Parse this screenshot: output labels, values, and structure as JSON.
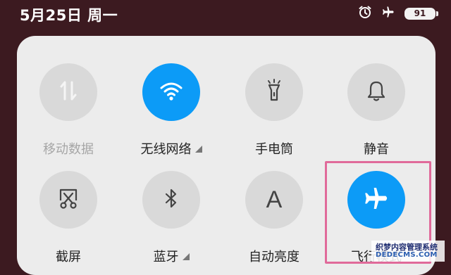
{
  "status_bar": {
    "date": "5月25日 周一",
    "battery_level": "91",
    "icons": [
      "alarm-icon",
      "airplane-icon",
      "battery-icon"
    ]
  },
  "tiles": [
    {
      "label": "移动数据",
      "icon": "data-arrows-icon",
      "active": false,
      "disabled": true
    },
    {
      "label": "无线网络",
      "icon": "wifi-icon",
      "active": true,
      "has_submenu": true
    },
    {
      "label": "手电筒",
      "icon": "flashlight-icon",
      "active": false
    },
    {
      "label": "静音",
      "icon": "bell-icon",
      "active": false
    },
    {
      "label": "截屏",
      "icon": "screenshot-scissors-icon",
      "active": false
    },
    {
      "label": "蓝牙",
      "icon": "bluetooth-icon",
      "active": false,
      "has_submenu": true
    },
    {
      "label": "自动亮度",
      "icon": "auto-brightness-icon",
      "active": false,
      "glyph": "A"
    },
    {
      "label": "飞行模式",
      "icon": "airplane-icon",
      "active": true
    }
  ],
  "colors": {
    "background": "#3c1a20",
    "panel": "#ececec",
    "active": "#0c9bf7",
    "inactive": "#d9d9d9",
    "highlight": "#e06a9a"
  },
  "watermark": {
    "line1": "织梦内容管理系统",
    "line2": "DEDECMS.COM"
  }
}
